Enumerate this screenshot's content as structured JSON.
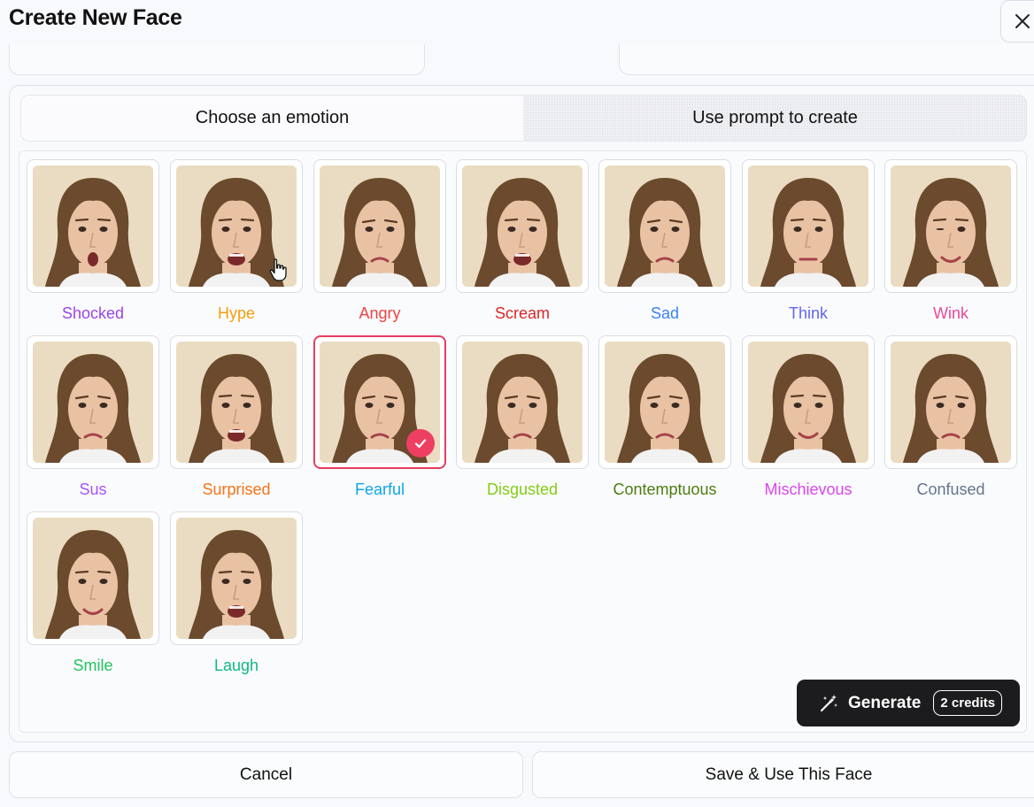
{
  "dialog": {
    "title": "Create New Face"
  },
  "tabs": [
    {
      "label": "Choose an emotion",
      "active": true
    },
    {
      "label": "Use prompt to create",
      "active": false
    }
  ],
  "emotions": [
    {
      "label": "Shocked",
      "color": "#9b45e8"
    },
    {
      "label": "Hype",
      "color": "#f59e0b"
    },
    {
      "label": "Angry",
      "color": "#ef4444"
    },
    {
      "label": "Scream",
      "color": "#dc2626"
    },
    {
      "label": "Sad",
      "color": "#3b82f6"
    },
    {
      "label": "Think",
      "color": "#6366f1"
    },
    {
      "label": "Wink",
      "color": "#ec4899"
    },
    {
      "label": "Sus",
      "color": "#a855f7"
    },
    {
      "label": "Surprised",
      "color": "#f97316"
    },
    {
      "label": "Fearful",
      "color": "#0ea5e9",
      "selected": true
    },
    {
      "label": "Disgusted",
      "color": "#84cc16"
    },
    {
      "label": "Contemptuous",
      "color": "#4d7c0f"
    },
    {
      "label": "Mischievous",
      "color": "#d946ef"
    },
    {
      "label": "Confused",
      "color": "#64748b"
    },
    {
      "label": "Smile",
      "color": "#22c55e"
    },
    {
      "label": "Laugh",
      "color": "#10b981"
    }
  ],
  "generate": {
    "label": "Generate",
    "credits": "2 credits"
  },
  "footer": {
    "cancel_label": "Cancel",
    "save_label": "Save & Use This Face"
  }
}
